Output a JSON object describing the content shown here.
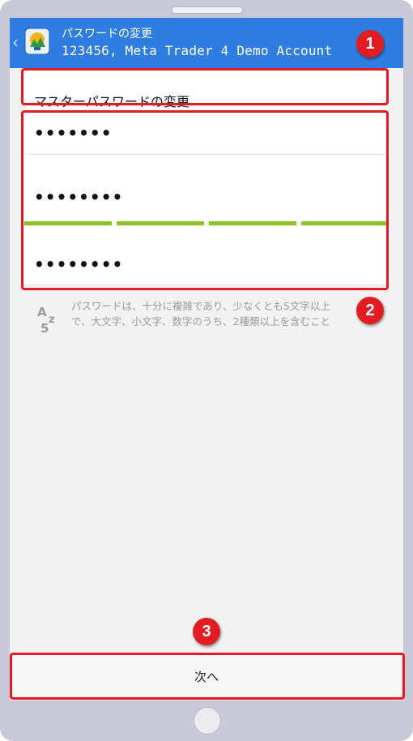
{
  "header": {
    "title": "パスワードの変更",
    "subtitle": "123456, Meta Trader 4 Demo Account"
  },
  "form": {
    "section_title": "マスターパスワードの変更",
    "current_password": "•••••••",
    "new_password": "••••••••",
    "confirm_password": "••••••••",
    "strength_segments": 4,
    "strength_color": "#8cc21f"
  },
  "hint": {
    "icon_label": "Az5",
    "line1": "パスワードは、十分に複雑であり、少なくとも5文字以上",
    "line2": "で、大文字、小文字、数字のうち、2種類以上を含むこと"
  },
  "footer": {
    "next_label": "次へ"
  },
  "annotations": {
    "badge1": "1",
    "badge2": "2",
    "badge3": "3",
    "color": "#e31c23"
  },
  "colors": {
    "topbar": "#2f7de1",
    "frame": "#c9c8d6"
  }
}
